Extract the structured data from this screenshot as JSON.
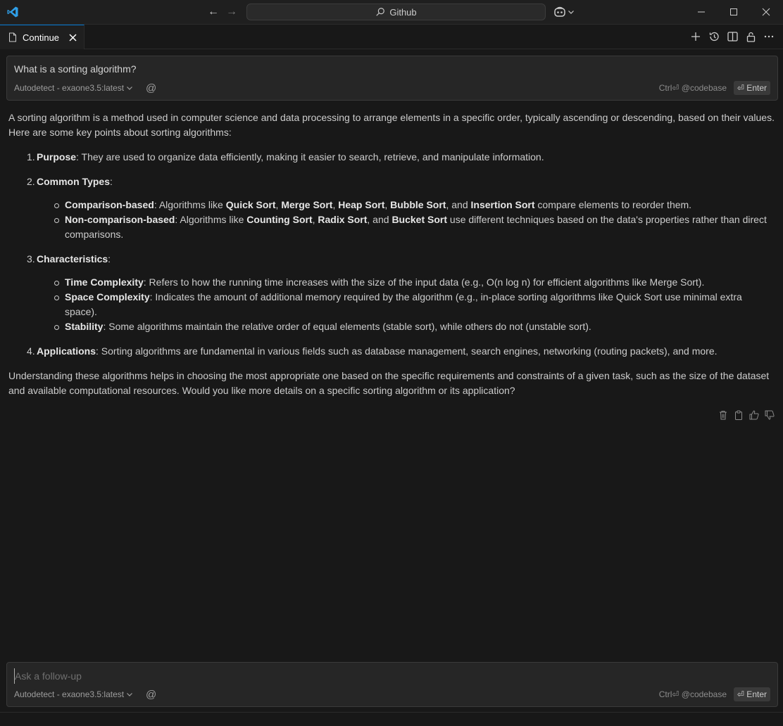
{
  "titlebar": {
    "search_label": "Github",
    "icons": [
      "vscode-logo",
      "back-arrow",
      "forward-arrow",
      "search-icon",
      "copilot-icon",
      "minimize-icon",
      "maximize-icon",
      "close-icon"
    ]
  },
  "tabbar": {
    "tab_label": "Continue",
    "actions": [
      "new-session",
      "history",
      "split-editor",
      "lock",
      "more"
    ]
  },
  "top_input": {
    "text": "What is a sorting algorithm?",
    "model": "Autodetect - exaone3.5:latest",
    "hint": "Ctrl⏎ @codebase",
    "enter_label": "⏎ Enter"
  },
  "response": {
    "intro": "A sorting algorithm is a method used in computer science and data processing to arrange elements in a specific order, typically ascending or descending, based on their values. Here are some key points about sorting algorithms:",
    "item1_num": "1.",
    "item1_title": "Purpose",
    "item1_text": ": They are used to organize data efficiently, making it easier to search, retrieve, and manipulate information.",
    "item2_num": "2.",
    "item2_title": "Common Types",
    "item2_suffix": ":",
    "item2_sub1_title": "Comparison-based",
    "item2_sub1_a": ": Algorithms like ",
    "quick_sort": "Quick Sort",
    "merge_sort": "Merge Sort",
    "heap_sort": "Heap Sort",
    "bubble_sort": "Bubble Sort",
    "insertion_sort": "Insertion Sort",
    "comma": ", ",
    "and_text": ", and ",
    "item2_sub1_end": " compare elements to reorder them.",
    "item2_sub2_title": "Non-comparison-based",
    "counting_sort": "Counting Sort",
    "radix_sort": "Radix Sort",
    "bucket_sort": "Bucket Sort",
    "item2_sub2_end": " use different techniques based on the data's properties rather than direct comparisons.",
    "item3_num": "3.",
    "item3_title": "Characteristics",
    "item3_suffix": ":",
    "item3_sub1_title": "Time Complexity",
    "item3_sub1_text": ": Refers to how the running time increases with the size of the input data (e.g., O(n log n) for efficient algorithms like Merge Sort).",
    "item3_sub2_title": "Space Complexity",
    "item3_sub2_text": ": Indicates the amount of additional memory required by the algorithm (e.g., in-place sorting algorithms like Quick Sort use minimal extra space).",
    "item3_sub3_title": "Stability",
    "item3_sub3_text": ": Some algorithms maintain the relative order of equal elements (stable sort), while others do not (unstable sort).",
    "item4_num": "4.",
    "item4_title": "Applications",
    "item4_text": ": Sorting algorithms are fundamental in various fields such as database management, search engines, networking (routing packets), and more.",
    "outro": "Understanding these algorithms helps in choosing the most appropriate one based on the specific requirements and constraints of a given task, such as the size of the dataset and available computational resources. Would you like more details on a specific sorting algorithm or its application?",
    "actions": [
      "delete",
      "copy",
      "thumbs-up",
      "thumbs-down"
    ]
  },
  "bottom_input": {
    "placeholder": "Ask a follow-up",
    "model": "Autodetect - exaone3.5:latest",
    "hint": "Ctrl⏎ @codebase",
    "enter_label": "⏎ Enter"
  },
  "colors": {
    "accent": "#0078d4",
    "background": "#181818",
    "input_bg": "#262626"
  }
}
